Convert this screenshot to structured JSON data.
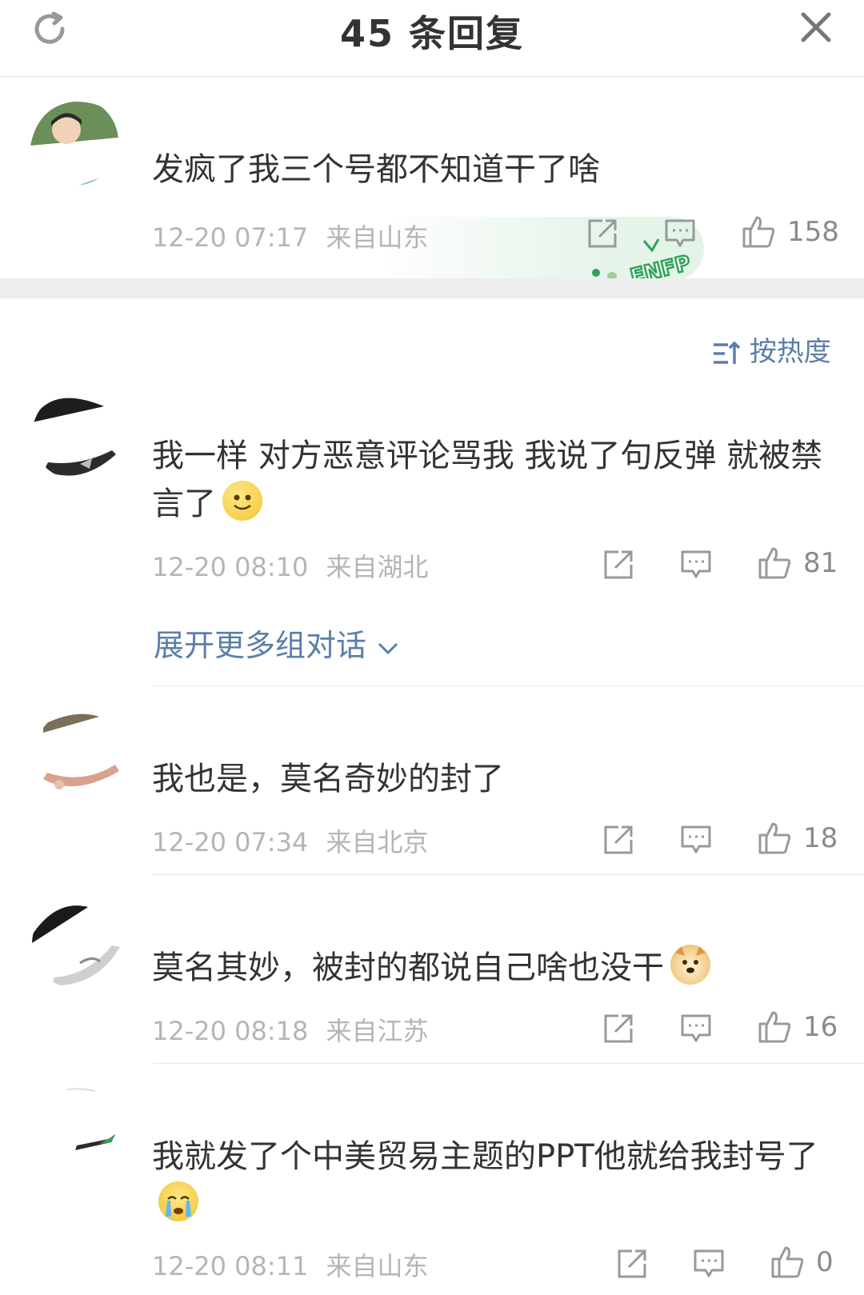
{
  "header": {
    "title": "45 条回复"
  },
  "main_post": {
    "text": "发疯了我三个号都不知道干了啥",
    "time": "12-20 07:17",
    "location": "来自山东",
    "likes": "158",
    "badge_text": "ENFP"
  },
  "sort": {
    "label": "按热度"
  },
  "comments": [
    {
      "text": "我一样 对方恶意评论骂我 我说了句反弹 就被禁言了",
      "emoji": "smile-emoji",
      "time": "12-20 08:10",
      "location": "来自湖北",
      "likes": "81",
      "expand": "展开更多组对话"
    },
    {
      "text": "我也是，莫名奇妙的封了",
      "time": "12-20 07:34",
      "location": "来自北京",
      "likes": "18"
    },
    {
      "text": "莫名其妙，被封的都说自己啥也没干",
      "emoji": "doge-emoji",
      "time": "12-20 08:18",
      "location": "来自江苏",
      "likes": "16"
    },
    {
      "text": "我就发了个中美贸易主题的PPT他就给我封号了",
      "emoji": "crying-emoji",
      "time": "12-20 08:11",
      "location": "来自山东",
      "likes": "0"
    }
  ],
  "colors": {
    "link": "#5b7ea8",
    "meta": "#b5b5b5",
    "text": "#333333",
    "band": "#eeeeee"
  }
}
